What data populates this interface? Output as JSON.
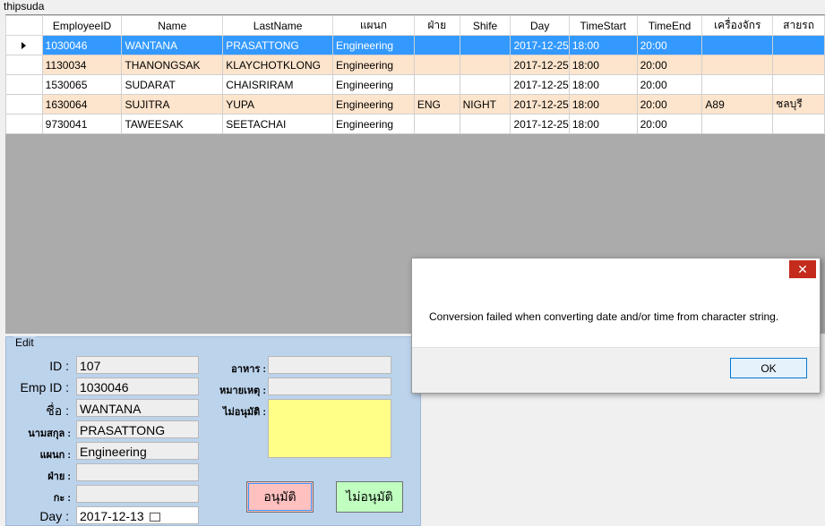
{
  "window": {
    "user_label": "thipsuda"
  },
  "grid": {
    "columns": [
      "EmployeeID",
      "Name",
      "LastName",
      "แผนก",
      "ฝ่าย",
      "Shife",
      "Day",
      "TimeStart",
      "TimeEnd",
      "เครื่องจักร",
      "สายรถ"
    ],
    "rows": [
      [
        "1030046",
        "WANTANA",
        "PRASATTONG",
        "Engineering",
        "",
        "",
        "2017-12-25",
        "18:00",
        "20:00",
        "",
        ""
      ],
      [
        "1130034",
        "THANONGSAK",
        "KLAYCHOTKLONG",
        "Engineering",
        "",
        "",
        "2017-12-25",
        "18:00",
        "20:00",
        "",
        ""
      ],
      [
        "1530065",
        "SUDARAT",
        "CHAISRIRAM",
        "Engineering",
        "",
        "",
        "2017-12-25",
        "18:00",
        "20:00",
        "",
        ""
      ],
      [
        "1630064",
        "SUJITRA",
        "YUPA",
        "Engineering",
        "ENG",
        "NIGHT",
        "2017-12-25",
        "18:00",
        "20:00",
        "A89",
        "ชลบุรี"
      ],
      [
        "9730041",
        "TAWEESAK",
        "SEETACHAI",
        "Engineering",
        "",
        "",
        "2017-12-25",
        "18:00",
        "20:00",
        "",
        ""
      ]
    ],
    "selected_row": 0,
    "colors": {
      "selected": "#3399ff",
      "alt": "#fde4cc",
      "empty_area": "#ababab"
    }
  },
  "edit": {
    "title": "Edit",
    "labels": {
      "id": "ID :",
      "emp_id": "Emp ID :",
      "name": "ชื่อ :",
      "lastname": "นามสกุล :",
      "dept": "แผนก :",
      "division": "ฝ่าย :",
      "shift": "กะ :",
      "day": "Day :",
      "food": "อาหาร :",
      "remark": "หมายเหตุ :",
      "reject_reason": "ไม่อนุมัติ :"
    },
    "values": {
      "id": "107",
      "emp_id": "1030046",
      "name": "WANTANA",
      "lastname": "PRASATTONG",
      "dept": "Engineering",
      "division": "",
      "shift": "",
      "day": "2017-12-13",
      "food": "",
      "remark": "",
      "reject_reason": ""
    },
    "buttons": {
      "approve": "อนุมัติ",
      "reject": "ไม่อนุมัติ"
    }
  },
  "dialog": {
    "message": "Conversion failed when converting date and/or time from character string.",
    "ok_label": "OK",
    "close_glyph": "✕"
  }
}
